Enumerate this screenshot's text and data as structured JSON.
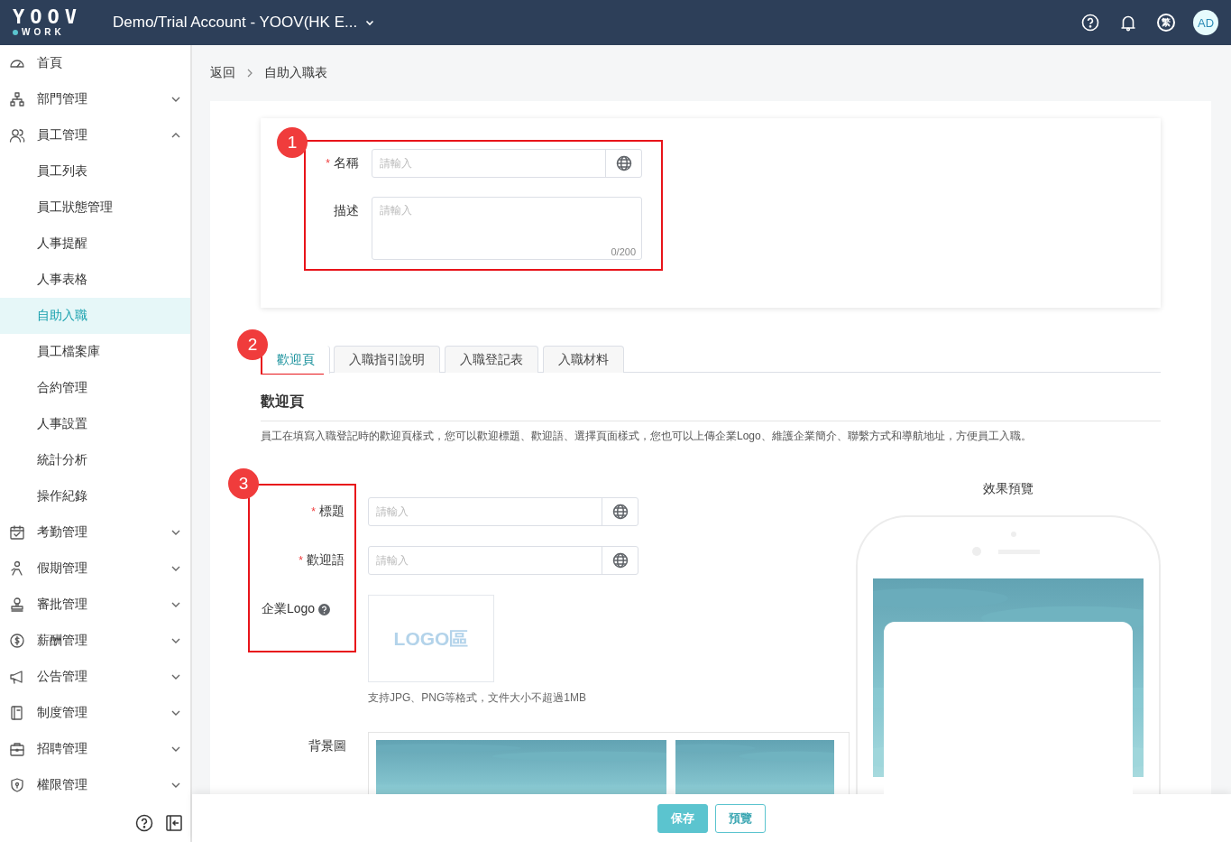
{
  "header": {
    "logo_top": "YOOV",
    "logo_bottom": "WORK",
    "account": "Demo/Trial Account - YOOV(HK E...",
    "language": "繁",
    "avatar": "AD"
  },
  "sidebar": {
    "items": [
      {
        "label": "首頁",
        "kind": "link",
        "selected": false
      },
      {
        "label": "部門管理",
        "kind": "group",
        "expanded": false,
        "selected": false
      },
      {
        "label": "員工管理",
        "kind": "group",
        "expanded": true,
        "selected": false,
        "children": [
          {
            "label": "員工列表",
            "selected": false
          },
          {
            "label": "員工狀態管理",
            "selected": false
          },
          {
            "label": "人事提醒",
            "selected": false
          },
          {
            "label": "人事表格",
            "selected": false
          },
          {
            "label": "自助入職",
            "selected": true
          },
          {
            "label": "員工檔案庫",
            "selected": false
          },
          {
            "label": "合約管理",
            "selected": false
          },
          {
            "label": "人事設置",
            "selected": false
          },
          {
            "label": "統計分析",
            "selected": false
          },
          {
            "label": "操作紀錄",
            "selected": false
          }
        ]
      },
      {
        "label": "考勤管理",
        "kind": "group",
        "expanded": false,
        "selected": false
      },
      {
        "label": "假期管理",
        "kind": "group",
        "expanded": false,
        "selected": false
      },
      {
        "label": "審批管理",
        "kind": "group",
        "expanded": false,
        "selected": false
      },
      {
        "label": "薪酬管理",
        "kind": "group",
        "expanded": false,
        "selected": false
      },
      {
        "label": "公告管理",
        "kind": "group",
        "expanded": false,
        "selected": false
      },
      {
        "label": "制度管理",
        "kind": "group",
        "expanded": false,
        "selected": false
      },
      {
        "label": "招聘管理",
        "kind": "group",
        "expanded": false,
        "selected": false
      },
      {
        "label": "權限管理",
        "kind": "group",
        "expanded": false,
        "selected": false
      }
    ]
  },
  "breadcrumb": {
    "back": "返回",
    "current": "自助入職表"
  },
  "basic_form": {
    "annotation": "1",
    "fields": [
      {
        "kind": "input",
        "label": "名稱",
        "required_mark": "*",
        "placeholder": "請輸入"
      },
      {
        "kind": "textarea",
        "label": "描述",
        "placeholder": "請輸入",
        "counter": "0/200"
      }
    ]
  },
  "tabs": {
    "items": [
      {
        "label": "歡迎頁",
        "selected": true,
        "annotation": "2"
      },
      {
        "label": "入職指引說明",
        "selected": false
      },
      {
        "label": "入職登記表",
        "selected": false
      },
      {
        "label": "入職材料",
        "selected": false
      }
    ]
  },
  "section": {
    "title": "歡迎頁",
    "description": "員工在填寫入職登記時的歡迎頁樣式，您可以歡迎標題、歡迎語、選擇頁面樣式，您也可以上傳企業Logo、維護企業簡介、聯繫方式和導航地址，方便員工入職。"
  },
  "welcome_form": {
    "annotation": "3",
    "fields": [
      {
        "kind": "input",
        "label": "標題",
        "required_mark": "*",
        "placeholder": "請輸入"
      },
      {
        "kind": "input",
        "label": "歡迎語",
        "required_mark": "*",
        "placeholder": "請輸入"
      },
      {
        "kind": "logo",
        "label": "企業Logo",
        "logo_text": "LOGO區",
        "hint": "支持JPG、PNG等格式，文件大小不超過1MB"
      },
      {
        "kind": "images",
        "label": "背景圖"
      }
    ]
  },
  "preview": {
    "title": "效果預覽"
  },
  "footer": {
    "buttons": [
      {
        "label": "保存",
        "kind": "primary"
      },
      {
        "label": "預覽",
        "kind": "secondary"
      }
    ]
  }
}
